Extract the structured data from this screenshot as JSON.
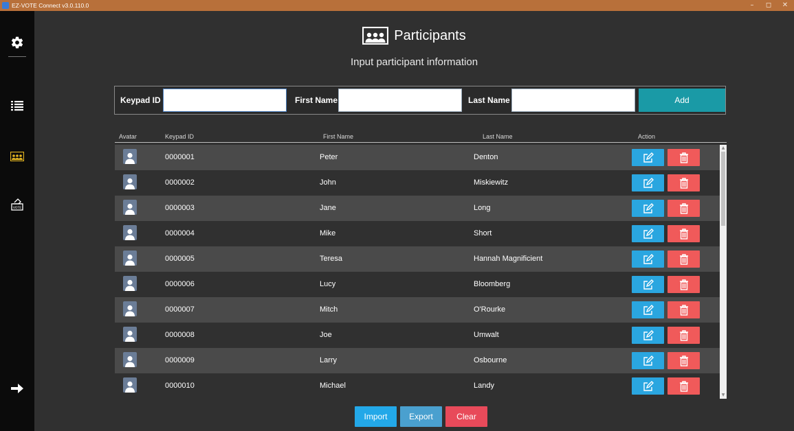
{
  "window": {
    "title": "EZ-VOTE Connect v3.0.110.0",
    "minimize_glyph": "–",
    "maximize_glyph": "◻",
    "close_glyph": "✕"
  },
  "sidebar": {
    "items": [
      {
        "icon": "gear-icon"
      },
      {
        "icon": "list-icon"
      },
      {
        "icon": "participants-icon"
      },
      {
        "icon": "vote-icon",
        "label": "VOTE"
      },
      {
        "icon": "arrow-right-icon"
      }
    ],
    "active_color": "#e3b421"
  },
  "header": {
    "title": "Participants",
    "subtitle": "Input participant information"
  },
  "form": {
    "keypad_label": "Keypad ID",
    "keypad_value": "",
    "first_name_label": "First Name",
    "first_name_value": "",
    "last_name_label": "Last Name",
    "last_name_value": "",
    "add_label": "Add"
  },
  "table": {
    "columns": [
      "Avatar",
      "Keypad ID",
      "First Name",
      "Last Name",
      "Action"
    ],
    "rows": [
      {
        "keypad": "0000001",
        "first": "Peter",
        "last": "Denton"
      },
      {
        "keypad": "0000002",
        "first": "John",
        "last": "Miskiewitz"
      },
      {
        "keypad": "0000003",
        "first": "Jane",
        "last": "Long"
      },
      {
        "keypad": "0000004",
        "first": "Mike",
        "last": "Short"
      },
      {
        "keypad": "0000005",
        "first": "Teresa",
        "last": "Hannah Magnificient"
      },
      {
        "keypad": "0000006",
        "first": "Lucy",
        "last": "Bloomberg"
      },
      {
        "keypad": "0000007",
        "first": "Mitch",
        "last": "O'Rourke"
      },
      {
        "keypad": "0000008",
        "first": "Joe",
        "last": "Umwalt"
      },
      {
        "keypad": "0000009",
        "first": "Larry",
        "last": "Osbourne"
      },
      {
        "keypad": "0000010",
        "first": "Michael",
        "last": "Landy"
      }
    ]
  },
  "actions": {
    "import_label": "Import",
    "export_label": "Export",
    "clear_label": "Clear"
  },
  "colors": {
    "titlebar": "#b8703a",
    "add": "#1a9aa6",
    "edit": "#2aa6e0",
    "delete": "#f05a5a",
    "import": "#23a8e8",
    "export": "#4aa0cf",
    "clear": "#e84a5a"
  }
}
